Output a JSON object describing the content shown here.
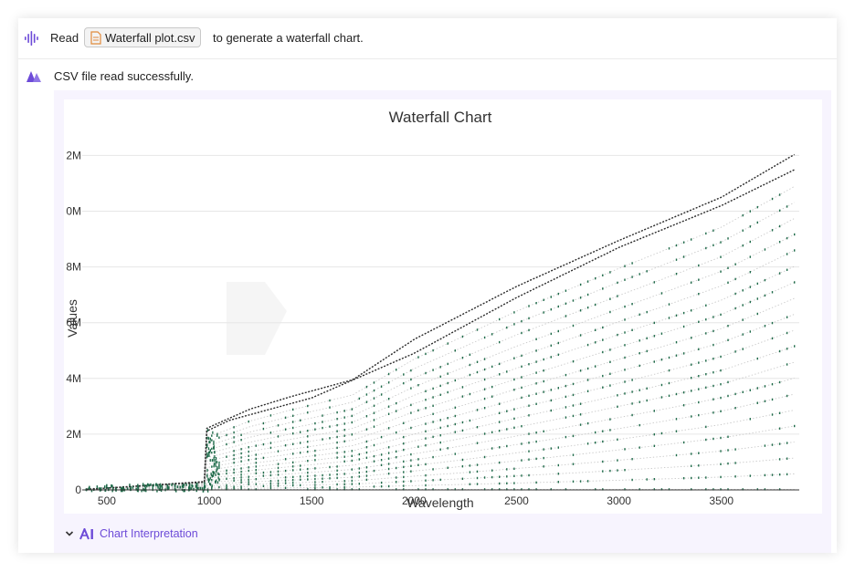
{
  "message": {
    "prefix": "Read",
    "file_name": "Waterfall plot.csv",
    "suffix": "to generate a waterfall chart.",
    "icon": "voice-waveform-icon",
    "file_icon": "document-icon"
  },
  "reply": {
    "icon": "assistant-logo-icon",
    "text": "CSV file read successfully."
  },
  "interpretation": {
    "label": "Chart Interpretation",
    "chevron": "chevron-down-icon",
    "icon": "ai-icon"
  },
  "colors": {
    "accent": "#6d4bd8",
    "file_icon": "#e08a3c",
    "series_dark": "#2b2b2b",
    "series_green": "#1f6b4a",
    "series_light": "#c8c8c8"
  },
  "chart_data": {
    "type": "scatter",
    "title": "Waterfall Chart",
    "xlabel": "Wavelength",
    "ylabel": "Values",
    "xlim": [
      380,
      3880
    ],
    "ylim": [
      0,
      12.7
    ],
    "x_ticks": [
      500,
      1000,
      1500,
      2000,
      2500,
      3000,
      3500
    ],
    "x_tick_labels": [
      "500",
      "1000",
      "1500",
      "2000",
      "2500",
      "3000",
      "3500"
    ],
    "y_ticks": [
      0,
      2,
      4,
      6,
      8,
      10,
      12
    ],
    "y_tick_labels": [
      "0",
      "2M",
      "4M",
      "6M",
      "8M",
      "0M",
      "2M"
    ],
    "grid": true,
    "x_range": [
      400,
      3860
    ],
    "step_x": 985,
    "series_count": 22,
    "top_series": {
      "x": [
        400,
        980,
        985,
        1000,
        1200,
        1400,
        1700,
        2000,
        2500,
        3000,
        3500,
        3860
      ],
      "y": [
        0.02,
        0.3,
        2.2,
        2.25,
        2.9,
        3.35,
        3.95,
        5.4,
        7.3,
        8.95,
        10.5,
        12.05
      ]
    },
    "second_series": {
      "x": [
        400,
        980,
        985,
        1100,
        1500,
        2000,
        2500,
        3000,
        3500,
        3860
      ],
      "y": [
        0.02,
        0.28,
        2.1,
        2.5,
        3.3,
        4.9,
        6.9,
        8.7,
        10.2,
        11.5
      ]
    }
  }
}
